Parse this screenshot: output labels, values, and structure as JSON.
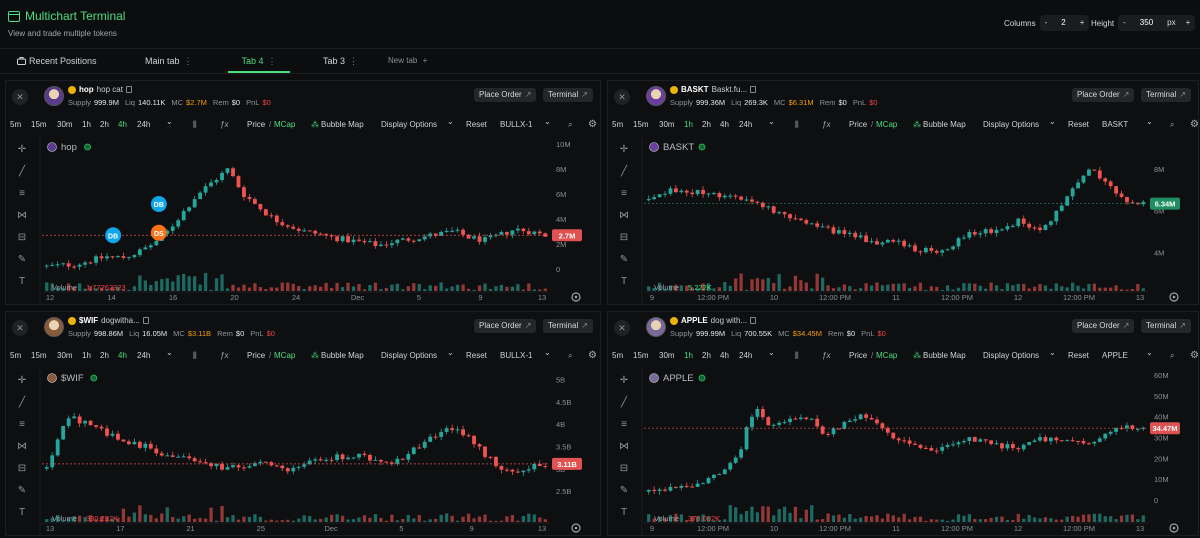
{
  "header": {
    "title": "Multichart Terminal",
    "subtitle": "View and trade multiple tokens",
    "columns_label": "Columns",
    "columns_value": "2",
    "height_label": "Height",
    "height_value": "350",
    "height_unit": "px",
    "minus": "-",
    "plus": "+"
  },
  "tabs": {
    "recent": "Recent Positions",
    "main": "Main tab",
    "tab4": "Tab 4",
    "tab3": "Tab 3",
    "new": "New tab",
    "new_plus": "+",
    "menu": "⋮",
    "active": "tab4"
  },
  "common": {
    "place_order": "Place Order",
    "terminal": "Terminal",
    "supply": "Supply",
    "liq": "Liq",
    "mc": "MC",
    "rem": "Rem",
    "pnl": "PnL",
    "close": "✕",
    "timeframes": [
      "5m",
      "15m",
      "30m",
      "1h",
      "2h",
      "4h",
      "24h"
    ],
    "price": "Price",
    "slash": "/",
    "mcap": "MCap",
    "bubble_map": "Bubble Map",
    "display_options": "Display Options",
    "reset": "Reset",
    "volume": "Volume",
    "chevron": "⌄"
  },
  "colors": {
    "accent": "#4ade80",
    "up": "#26a69a",
    "down": "#ef5350",
    "warn": "#f59e0b",
    "background": "#0c0d0f"
  },
  "panels": [
    {
      "name": "hop",
      "desc": "hop cat",
      "supply": "999.9M",
      "liq": "140.11K",
      "mc": "$2.7M",
      "rem": "$0",
      "pnl": "$0",
      "active_timeframe": "4h",
      "preset": "BULLX-1",
      "legend": "hop",
      "volume_value": "1.77262323",
      "volume_color": "#ef4444",
      "price_tag": "2.7M",
      "price_tag_color": "#e05252",
      "marker_labels": [
        "DB",
        "DB",
        "DS"
      ],
      "chart_data": {
        "type": "candlestick",
        "y_ticks": [
          "10M",
          "8M",
          "6M",
          "4M",
          "2M",
          "0"
        ],
        "y_range": [
          0,
          10
        ],
        "current": 2.7,
        "x_ticks": [
          "12",
          "14",
          "16",
          "20",
          "24",
          "Dec",
          "5",
          "9",
          "13"
        ],
        "path": [
          0.2,
          0.3,
          0.4,
          0.7,
          1.0,
          0.9,
          1.3,
          2.0,
          3.0,
          4.5,
          6.0,
          7.0,
          8.0,
          6.0,
          5.0,
          4.0,
          3.5,
          3.0,
          2.8,
          2.5,
          2.3,
          2.1,
          1.9,
          2.2,
          2.4,
          2.6,
          2.8,
          3.0,
          2.5,
          2.3,
          2.7,
          3.2,
          3.0,
          2.7
        ],
        "markers": [
          {
            "label": "DB",
            "x": 0.14,
            "y": 2.7,
            "color": "#0ea5e9"
          },
          {
            "label": "DB",
            "x": 0.23,
            "y": 5.2,
            "color": "#0ea5e9"
          },
          {
            "label": "DS",
            "x": 0.23,
            "y": 2.9,
            "color": "#f97316"
          }
        ]
      }
    },
    {
      "name": "BASKT",
      "desc": "Baskt.fu...",
      "supply": "999.36M",
      "liq": "269.3K",
      "mc": "$6.31M",
      "rem": "$0",
      "pnl": "$0",
      "active_timeframe": "1h",
      "preset": "BASKT",
      "legend": "BASKT",
      "volume_value": "5.222K",
      "volume_color": "#4ade80",
      "price_tag": "6.34M",
      "price_tag_color": "#1f8f63",
      "marker_labels": [],
      "chart_data": {
        "type": "candlestick",
        "y_ticks": [
          "8M",
          "6M",
          "4M"
        ],
        "y_range": [
          3.2,
          9.2
        ],
        "current": 6.34,
        "x_ticks": [
          "9",
          "12:00 PM",
          "10",
          "12:00 PM",
          "11",
          "12:00 PM",
          "12",
          "12:00 PM",
          "13"
        ],
        "path": [
          6.5,
          7.0,
          6.8,
          6.9,
          6.7,
          6.6,
          6.3,
          6.0,
          5.6,
          5.4,
          5.1,
          5.0,
          4.7,
          4.4,
          4.6,
          4.2,
          4.0,
          4.3,
          4.8,
          5.0,
          5.2,
          5.5,
          5.0,
          5.8,
          7.0,
          8.0,
          7.2,
          6.5,
          6.3
        ]
      }
    },
    {
      "name": "$WIF",
      "desc": "dogwitha...",
      "supply": "998.86M",
      "liq": "16.05M",
      "mc": "$3.11B",
      "rem": "$0",
      "pnl": "$0",
      "active_timeframe": "4h",
      "preset": "BULLX-1",
      "legend": "$WIF",
      "volume_value": "330.232K",
      "volume_color": "#ef4444",
      "price_tag": "3.11B",
      "price_tag_color": "#e05252",
      "marker_labels": [],
      "chart_data": {
        "type": "candlestick",
        "y_ticks": [
          "5B",
          "4.5B",
          "4B",
          "3.5B",
          "3B",
          "2.5B"
        ],
        "y_range": [
          2.3,
          5.1
        ],
        "current": 3.11,
        "x_ticks": [
          "13",
          "17",
          "21",
          "25",
          "Dec",
          "5",
          "9",
          "13"
        ],
        "path": [
          3.0,
          4.2,
          4.0,
          3.8,
          3.6,
          3.5,
          3.3,
          3.2,
          3.1,
          3.0,
          3.1,
          3.15,
          3.0,
          3.1,
          3.2,
          3.3,
          3.25,
          3.1,
          3.3,
          3.6,
          3.9,
          3.8,
          3.3,
          2.9,
          3.0,
          3.1
        ]
      }
    },
    {
      "name": "APPLE",
      "desc": "dog with...",
      "supply": "999.99M",
      "liq": "700.55K",
      "mc": "$34.45M",
      "rem": "$0",
      "pnl": "$0",
      "active_timeframe": "1h",
      "preset": "APPLE",
      "legend": "APPLE",
      "volume_value": "378.002K",
      "volume_color": "#ef4444",
      "price_tag": "34.47M",
      "price_tag_color": "#e05252",
      "marker_labels": [],
      "chart_data": {
        "type": "candlestick",
        "y_ticks": [
          "60M",
          "50M",
          "40M",
          "30M",
          "20M",
          "10M",
          "0"
        ],
        "y_range": [
          0,
          60
        ],
        "current": 34.47,
        "x_ticks": [
          "9",
          "12:00 PM",
          "10",
          "12:00 PM",
          "11",
          "12:00 PM",
          "12",
          "12:00 PM",
          "13"
        ],
        "path": [
          4,
          5,
          6,
          8,
          12,
          20,
          45,
          35,
          38,
          40,
          32,
          36,
          42,
          36,
          30,
          28,
          24,
          27,
          30,
          28,
          26,
          25,
          30,
          29,
          27,
          28,
          33,
          36,
          34
        ]
      }
    }
  ]
}
